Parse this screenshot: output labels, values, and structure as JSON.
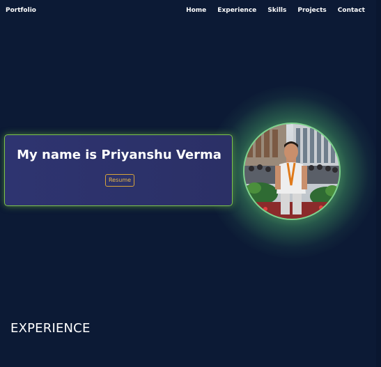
{
  "navbar": {
    "brand": "Portfolio",
    "links": [
      "Home",
      "Experience",
      "Skills",
      "Projects",
      "Contact"
    ]
  },
  "hero": {
    "name": "My name is Priyanshu Verma",
    "resume_label": "Resume"
  },
  "sections": {
    "experience_title": "EXPERIENCE"
  },
  "colors": {
    "background": "#0c1a35",
    "card": "#2e3470",
    "card_border": "#7ec24a",
    "glow": "#96e68c",
    "resume_accent": "#e8b84a"
  }
}
